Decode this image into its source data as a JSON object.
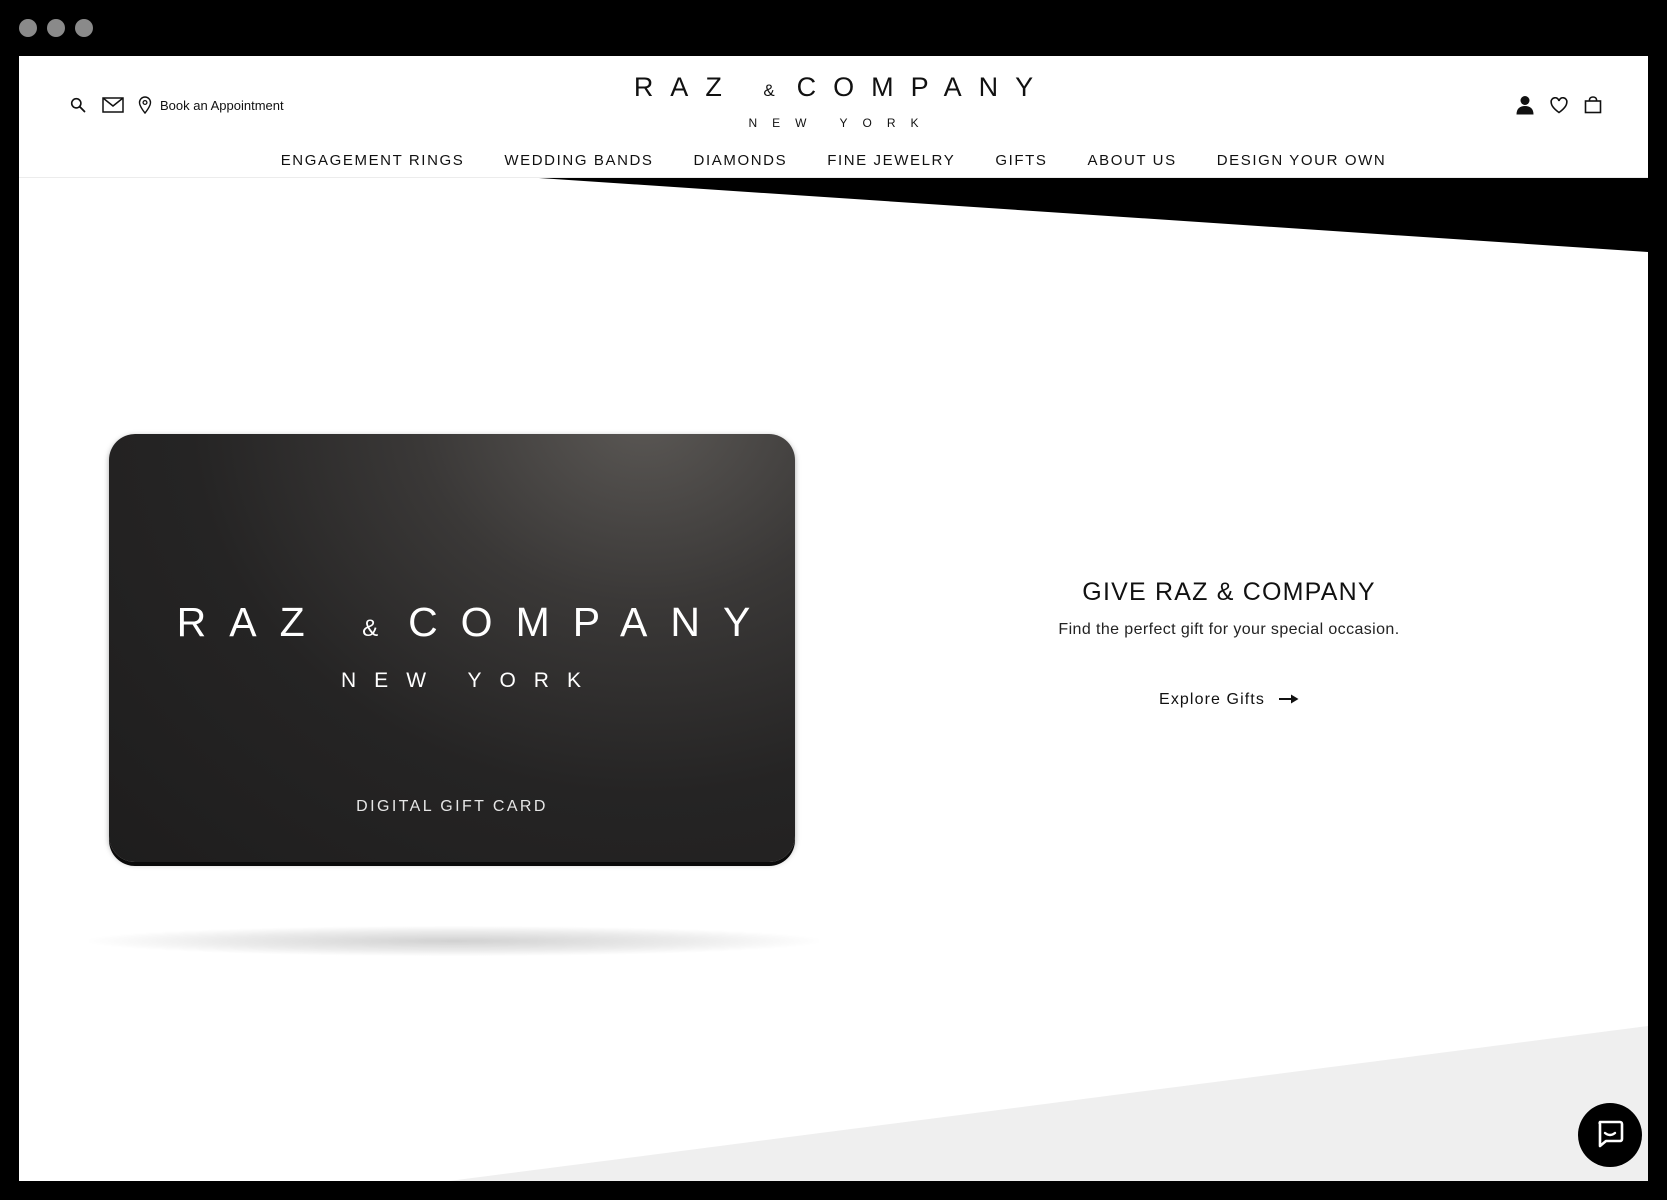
{
  "header": {
    "appointment_label": "Book an Appointment",
    "logo_main_left": "RAZ",
    "logo_amp": "&",
    "logo_main_right": "COMPANY",
    "logo_sub": "NEW YORK"
  },
  "nav": {
    "items": [
      {
        "label": "ENGAGEMENT RINGS"
      },
      {
        "label": "WEDDING BANDS"
      },
      {
        "label": "DIAMONDS"
      },
      {
        "label": "FINE JEWELRY"
      },
      {
        "label": "GIFTS"
      },
      {
        "label": "ABOUT US"
      },
      {
        "label": "DESIGN YOUR OWN"
      }
    ]
  },
  "gift_card": {
    "brand_left": "RAZ",
    "brand_amp": "&",
    "brand_right": "COMPANY",
    "brand_sub": "NEW YORK",
    "label": "DIGITAL GIFT CARD"
  },
  "promo": {
    "title": "GIVE RAZ & COMPANY",
    "description": "Find the perfect gift for your special occasion.",
    "cta_label": "Explore Gifts"
  },
  "icons": {
    "search": "search-icon",
    "mail": "mail-icon",
    "location": "location-pin-icon",
    "account": "user-icon",
    "wishlist": "heart-icon",
    "cart": "shopping-bag-icon",
    "cta_arrow": "arrow-right-icon",
    "chat": "chat-icon"
  },
  "colors": {
    "frame": "#000000",
    "page_bg": "#ffffff",
    "text": "#111111",
    "card": "#232222",
    "accent_shape": "#000000"
  }
}
